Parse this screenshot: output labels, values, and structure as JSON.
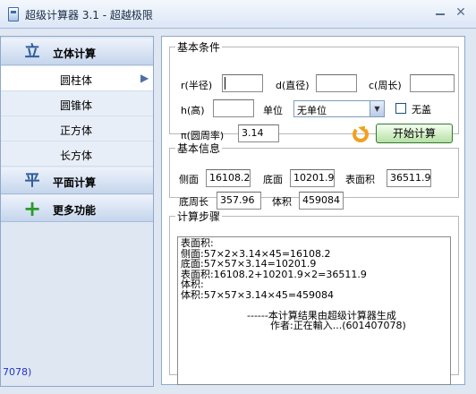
{
  "window": {
    "title": "超级计算器 3.1 - 超越极限",
    "minimize_icon": "minimize-icon",
    "close_icon": "close-icon"
  },
  "sidebar": {
    "groups": [
      {
        "label": "立体计算",
        "icon": "立"
      },
      {
        "label": "平面计算",
        "icon": "平"
      },
      {
        "label": "更多功能",
        "icon": "+"
      }
    ],
    "items": [
      {
        "label": "圆柱体",
        "active": true
      },
      {
        "label": "圆锥体"
      },
      {
        "label": "正方体"
      },
      {
        "label": "长方体"
      }
    ],
    "footer_text": "7078)"
  },
  "conditions": {
    "legend": "基本条件",
    "radius_label": "r(半径)",
    "radius_value": "",
    "diameter_label": "d(直径)",
    "diameter_value": "",
    "circumference_label": "c(周长)",
    "circumference_value": "",
    "height_label": "h(高)",
    "height_value": "",
    "unit_label": "单位",
    "unit_value": "无单位",
    "no_lid_label": "无盖",
    "pi_label": "π(圆周率)",
    "pi_value": "3.14",
    "calc_button": "开始计算"
  },
  "info": {
    "legend": "基本信息",
    "lateral_label": "侧面",
    "lateral_value": "16108.2",
    "base_label": "底面",
    "base_value": "10201.9",
    "surface_label": "表面积",
    "surface_value": "36511.9",
    "base_perimeter_label": "底周长",
    "base_perimeter_value": "357.96",
    "volume_label": "体积",
    "volume_value": "459084"
  },
  "steps": {
    "legend": "计算步骤",
    "lines": [
      "表面积:",
      "侧面:57×2×3.14×45=16108.2",
      "底面:57×57×3.14=10201.9",
      "表面积:16108.2+10201.9×2=36511.9",
      "",
      "体积:",
      "体积:57×57×3.14×45=459084"
    ],
    "signature": "------本计算结果由超级计算器生成",
    "author": "作者:正在輸入...(601407078)"
  }
}
